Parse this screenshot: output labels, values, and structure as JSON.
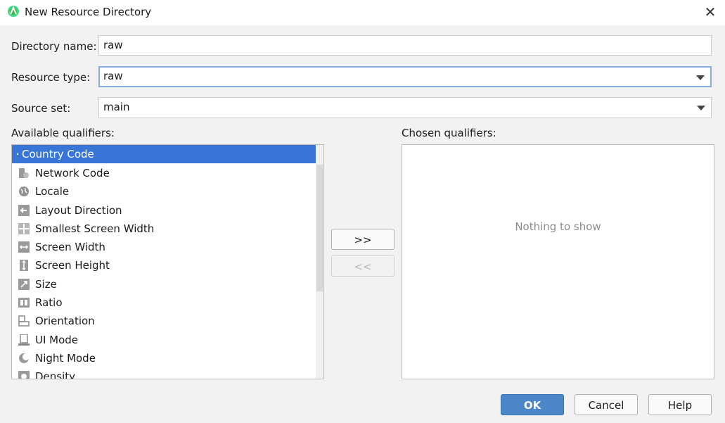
{
  "window": {
    "title": "New Resource Directory",
    "close_glyph": "✕"
  },
  "form": {
    "directory_name_label": "Directory name:",
    "directory_name_value": "raw",
    "resource_type_label": "Resource type:",
    "resource_type_value": "raw",
    "source_set_label": "Source set:",
    "source_set_value": "main"
  },
  "available": {
    "label": "Available qualifiers:",
    "items": [
      {
        "label": "Country Code",
        "icon": "country-code-icon"
      },
      {
        "label": "Network Code",
        "icon": "network-code-icon"
      },
      {
        "label": "Locale",
        "icon": "globe-icon"
      },
      {
        "label": "Layout Direction",
        "icon": "layout-direction-icon"
      },
      {
        "label": "Smallest Screen Width",
        "icon": "smallest-width-icon"
      },
      {
        "label": "Screen Width",
        "icon": "screen-width-icon"
      },
      {
        "label": "Screen Height",
        "icon": "screen-height-icon"
      },
      {
        "label": "Size",
        "icon": "size-icon"
      },
      {
        "label": "Ratio",
        "icon": "ratio-icon"
      },
      {
        "label": "Orientation",
        "icon": "orientation-icon"
      },
      {
        "label": "UI Mode",
        "icon": "ui-mode-icon"
      },
      {
        "label": "Night Mode",
        "icon": "night-mode-icon"
      },
      {
        "label": "Density",
        "icon": "density-icon"
      }
    ]
  },
  "chosen": {
    "label": "Chosen qualifiers:",
    "empty_text": "Nothing to show"
  },
  "transfer": {
    "add_label": ">>",
    "remove_label": "<<"
  },
  "buttons": {
    "ok": "OK",
    "cancel": "Cancel",
    "help": "Help"
  },
  "colors": {
    "selection": "#3875d7",
    "primary": "#4a86c8",
    "focus_border": "#86aee0"
  }
}
